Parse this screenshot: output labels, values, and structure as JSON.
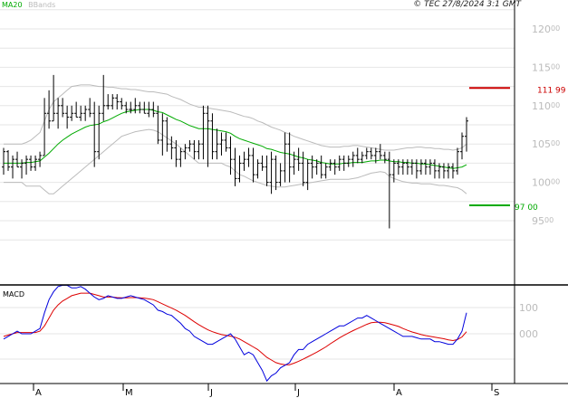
{
  "header": {
    "legend_ma": "MA20",
    "legend_bb": "BBands",
    "copyright": "© TEC 27/8/2024 3:1 GMT"
  },
  "colors": {
    "ma": "#00aa00",
    "bands": "#bbbbbb",
    "bars": "#000000",
    "resistance": "#cc0000",
    "support": "#00aa00",
    "macd": "#0000dd",
    "signal": "#dd0000"
  },
  "chart_data": [
    {
      "type": "ohlc",
      "ylim": [
        9100,
        12300
      ],
      "yticks": [
        "12000",
        "11500",
        "11000",
        "10500",
        "10000",
        "9500"
      ],
      "grid": true,
      "levels": [
        {
          "label": "111 99",
          "value": 11230,
          "color": "#cc0000"
        },
        {
          "label": "97 00",
          "value": 9700,
          "color": "#00aa00"
        }
      ],
      "ohlc": [
        [
          10200,
          10450,
          10100,
          10400
        ],
        [
          10400,
          10420,
          10150,
          10200
        ],
        [
          10200,
          10350,
          10050,
          10300
        ],
        [
          10300,
          10400,
          10200,
          10200
        ],
        [
          10200,
          10300,
          10050,
          10250
        ],
        [
          10250,
          10350,
          10100,
          10300
        ],
        [
          10300,
          10350,
          10150,
          10200
        ],
        [
          10200,
          10350,
          10150,
          10300
        ],
        [
          10300,
          10400,
          10200,
          10350
        ],
        [
          10350,
          11100,
          10350,
          10900
        ],
        [
          10900,
          11200,
          10700,
          10800
        ],
        [
          10800,
          11400,
          10800,
          10900
        ],
        [
          10900,
          11100,
          10700,
          11000
        ],
        [
          11000,
          11100,
          10850,
          10900
        ],
        [
          10900,
          11000,
          10700,
          10850
        ],
        [
          10850,
          11000,
          10800,
          10900
        ],
        [
          10900,
          11050,
          10850,
          10850
        ],
        [
          10850,
          11000,
          10800,
          10900
        ],
        [
          10900,
          11000,
          10800,
          10950
        ],
        [
          10950,
          11100,
          10850,
          10900
        ],
        [
          10900,
          11050,
          10200,
          10400
        ],
        [
          10400,
          11000,
          10300,
          10900
        ],
        [
          10900,
          11400,
          10800,
          11000
        ],
        [
          11000,
          11150,
          10950,
          11000
        ],
        [
          11000,
          11150,
          10950,
          11100
        ],
        [
          11100,
          11150,
          10950,
          11050
        ],
        [
          11050,
          11100,
          10950,
          11000
        ],
        [
          11000,
          11050,
          10900,
          10950
        ],
        [
          10950,
          11050,
          10900,
          10950
        ],
        [
          10950,
          11100,
          10900,
          11000
        ],
        [
          11000,
          11050,
          10900,
          10950
        ],
        [
          10950,
          11050,
          10900,
          10900
        ],
        [
          10900,
          11050,
          10850,
          10950
        ],
        [
          10950,
          11050,
          10850,
          10900
        ],
        [
          10900,
          11000,
          10500,
          10550
        ],
        [
          10550,
          10900,
          10350,
          10800
        ],
        [
          10800,
          10850,
          10400,
          10500
        ],
        [
          10500,
          10600,
          10300,
          10450
        ],
        [
          10450,
          10550,
          10200,
          10300
        ],
        [
          10300,
          10450,
          10200,
          10400
        ],
        [
          10400,
          10500,
          10300,
          10450
        ],
        [
          10450,
          10550,
          10400,
          10500
        ],
        [
          10500,
          10550,
          10300,
          10400
        ],
        [
          10400,
          10550,
          10300,
          10500
        ],
        [
          10500,
          11000,
          10300,
          10900
        ],
        [
          10900,
          11000,
          10200,
          10800
        ],
        [
          10800,
          10900,
          10300,
          10400
        ],
        [
          10400,
          10700,
          10300,
          10500
        ],
        [
          10500,
          10650,
          10350,
          10550
        ],
        [
          10550,
          10650,
          10400,
          10450
        ],
        [
          10450,
          10600,
          10100,
          10300
        ],
        [
          10300,
          10450,
          9950,
          10050
        ],
        [
          10050,
          10350,
          10000,
          10250
        ],
        [
          10250,
          10400,
          10150,
          10300
        ],
        [
          10300,
          10450,
          10200,
          10350
        ],
        [
          10350,
          10450,
          10000,
          10100
        ],
        [
          10100,
          10300,
          10050,
          10250
        ],
        [
          10250,
          10350,
          10150,
          10200
        ],
        [
          10200,
          10350,
          9950,
          10000
        ],
        [
          10000,
          10400,
          9850,
          10300
        ],
        [
          10300,
          10350,
          9900,
          10000
        ],
        [
          10000,
          10250,
          9950,
          10150
        ],
        [
          10150,
          10650,
          10000,
          10500
        ],
        [
          10500,
          10650,
          10000,
          10200
        ],
        [
          10200,
          10400,
          10100,
          10300
        ],
        [
          10300,
          10450,
          10150,
          10250
        ],
        [
          10250,
          10400,
          9950,
          10000
        ],
        [
          10000,
          10300,
          9900,
          10250
        ],
        [
          10250,
          10350,
          10050,
          10200
        ],
        [
          10200,
          10300,
          10100,
          10250
        ],
        [
          10250,
          10350,
          10050,
          10100
        ],
        [
          10100,
          10250,
          10050,
          10200
        ],
        [
          10200,
          10300,
          10150,
          10250
        ],
        [
          10250,
          10300,
          10100,
          10200
        ],
        [
          10200,
          10350,
          10150,
          10300
        ],
        [
          10300,
          10350,
          10150,
          10250
        ],
        [
          10250,
          10350,
          10200,
          10300
        ],
        [
          10300,
          10400,
          10200,
          10350
        ],
        [
          10350,
          10450,
          10250,
          10300
        ],
        [
          10300,
          10400,
          10250,
          10350
        ],
        [
          10350,
          10450,
          10300,
          10400
        ],
        [
          10400,
          10450,
          10300,
          10350
        ],
        [
          10350,
          10450,
          10250,
          10400
        ],
        [
          10400,
          10500,
          10300,
          10350
        ],
        [
          10350,
          10400,
          10250,
          10300
        ],
        [
          10300,
          10400,
          9400,
          10100
        ],
        [
          10100,
          10300,
          10000,
          10250
        ],
        [
          10250,
          10300,
          10100,
          10200
        ],
        [
          10200,
          10300,
          10100,
          10250
        ],
        [
          10250,
          10300,
          10100,
          10200
        ],
        [
          10200,
          10300,
          10100,
          10250
        ],
        [
          10250,
          10300,
          10050,
          10150
        ],
        [
          10150,
          10300,
          10100,
          10250
        ],
        [
          10250,
          10300,
          10100,
          10200
        ],
        [
          10200,
          10300,
          10100,
          10250
        ],
        [
          10250,
          10300,
          10050,
          10150
        ],
        [
          10150,
          10250,
          10050,
          10200
        ],
        [
          10200,
          10250,
          10050,
          10150
        ],
        [
          10150,
          10250,
          10050,
          10200
        ],
        [
          10200,
          10250,
          10050,
          10150
        ],
        [
          10150,
          10450,
          10100,
          10400
        ],
        [
          10400,
          10650,
          10300,
          10600
        ],
        [
          10600,
          10850,
          10400,
          10800
        ]
      ],
      "ma20": [
        10250,
        10250,
        10250,
        10250,
        10250,
        10260,
        10260,
        10270,
        10280,
        10330,
        10380,
        10440,
        10500,
        10550,
        10590,
        10630,
        10660,
        10690,
        10720,
        10740,
        10750,
        10760,
        10790,
        10810,
        10840,
        10870,
        10900,
        10920,
        10930,
        10940,
        10950,
        10950,
        10950,
        10940,
        10920,
        10910,
        10880,
        10850,
        10820,
        10800,
        10770,
        10740,
        10720,
        10700,
        10700,
        10700,
        10690,
        10680,
        10670,
        10660,
        10640,
        10600,
        10570,
        10550,
        10530,
        10510,
        10490,
        10470,
        10440,
        10430,
        10410,
        10390,
        10380,
        10370,
        10350,
        10330,
        10320,
        10300,
        10290,
        10280,
        10260,
        10250,
        10240,
        10240,
        10240,
        10250,
        10250,
        10260,
        10260,
        10260,
        10270,
        10280,
        10280,
        10290,
        10290,
        10280,
        10270,
        10270,
        10260,
        10260,
        10250,
        10250,
        10240,
        10240,
        10230,
        10220,
        10210,
        10200,
        10190,
        10180,
        10190,
        10200,
        10230
      ],
      "bb_upper": [
        10500,
        10500,
        10500,
        10500,
        10500,
        10520,
        10550,
        10600,
        10650,
        10800,
        10950,
        11050,
        11100,
        11150,
        11200,
        11250,
        11260,
        11270,
        11270,
        11270,
        11260,
        11250,
        11250,
        11240,
        11240,
        11230,
        11220,
        11220,
        11210,
        11210,
        11200,
        11190,
        11180,
        11180,
        11170,
        11160,
        11150,
        11120,
        11100,
        11080,
        11050,
        11020,
        11000,
        10980,
        10980,
        10970,
        10960,
        10950,
        10940,
        10930,
        10920,
        10900,
        10880,
        10860,
        10850,
        10830,
        10800,
        10780,
        10750,
        10720,
        10700,
        10680,
        10650,
        10630,
        10600,
        10580,
        10560,
        10540,
        10520,
        10500,
        10480,
        10470,
        10460,
        10460,
        10460,
        10470,
        10470,
        10480,
        10480,
        10470,
        10460,
        10450,
        10440,
        10430,
        10420,
        10420,
        10420,
        10430,
        10440,
        10450,
        10450,
        10460,
        10460,
        10450,
        10450,
        10440,
        10440,
        10430,
        10430,
        10420,
        10430,
        10450,
        10500
      ],
      "bb_lower": [
        10000,
        10000,
        10000,
        10000,
        10000,
        9950,
        9950,
        9950,
        9950,
        9900,
        9850,
        9850,
        9900,
        9950,
        10000,
        10050,
        10100,
        10150,
        10200,
        10250,
        10300,
        10350,
        10400,
        10450,
        10500,
        10550,
        10600,
        10620,
        10640,
        10660,
        10670,
        10680,
        10690,
        10680,
        10660,
        10620,
        10580,
        10540,
        10500,
        10450,
        10400,
        10350,
        10300,
        10250,
        10250,
        10250,
        10250,
        10250,
        10250,
        10220,
        10200,
        10150,
        10100,
        10080,
        10050,
        10020,
        10000,
        9980,
        9960,
        9950,
        9940,
        9940,
        9940,
        9950,
        9960,
        9970,
        9980,
        9990,
        10000,
        10010,
        10020,
        10030,
        10040,
        10040,
        10040,
        10040,
        10040,
        10050,
        10060,
        10080,
        10100,
        10120,
        10130,
        10140,
        10130,
        10080,
        10050,
        10030,
        10010,
        10000,
        9990,
        9990,
        9980,
        9980,
        9980,
        9970,
        9960,
        9960,
        9950,
        9940,
        9930,
        9900,
        9850
      ]
    },
    {
      "type": "line",
      "ylim": [
        -300,
        250
      ],
      "yticks": [
        "100",
        "000"
      ],
      "series": [
        {
          "values": [
            -20,
            -10,
            0,
            10,
            0,
            0,
            0,
            10,
            20,
            80,
            130,
            160,
            180,
            185,
            185,
            175,
            175,
            180,
            170,
            155,
            140,
            130,
            135,
            145,
            140,
            135,
            135,
            140,
            145,
            140,
            135,
            130,
            120,
            110,
            90,
            85,
            75,
            70,
            55,
            40,
            20,
            10,
            -10,
            -20,
            -30,
            -40,
            -40,
            -30,
            -20,
            -10,
            0,
            -20,
            -50,
            -80,
            -70,
            -80,
            -110,
            -140,
            -180,
            -160,
            -150,
            -130,
            -120,
            -110,
            -80,
            -60,
            -60,
            -40,
            -30,
            -20,
            -10,
            0,
            10,
            20,
            30,
            30,
            40,
            50,
            60,
            60,
            70,
            60,
            50,
            40,
            30,
            20,
            10,
            0,
            -10,
            -10,
            -10,
            -15,
            -20,
            -20,
            -20,
            -30,
            -30,
            -35,
            -40,
            -40,
            -20,
            10,
            80
          ]
        },
        {
          "values": [
            -10,
            -5,
            0,
            5,
            5,
            5,
            5,
            5,
            10,
            30,
            60,
            90,
            110,
            125,
            135,
            145,
            150,
            155,
            155,
            155,
            150,
            145,
            140,
            140,
            140,
            138,
            137,
            137,
            138,
            138,
            137,
            136,
            133,
            130,
            122,
            114,
            106,
            98,
            90,
            80,
            70,
            58,
            46,
            35,
            25,
            15,
            8,
            2,
            -3,
            -6,
            -9,
            -13,
            -20,
            -30,
            -40,
            -50,
            -60,
            -75,
            -90,
            -100,
            -110,
            -115,
            -118,
            -118,
            -112,
            -105,
            -97,
            -88,
            -79,
            -70,
            -60,
            -50,
            -38,
            -27,
            -16,
            -6,
            3,
            12,
            20,
            28,
            36,
            42,
            44,
            44,
            42,
            38,
            33,
            28,
            20,
            13,
            7,
            2,
            -3,
            -7,
            -10,
            -13,
            -16,
            -19,
            -23,
            -26,
            -22,
            -12,
            8
          ]
        }
      ]
    }
  ],
  "xaxis": {
    "months": [
      "A",
      "M",
      "J",
      "J",
      "A",
      "S"
    ]
  }
}
